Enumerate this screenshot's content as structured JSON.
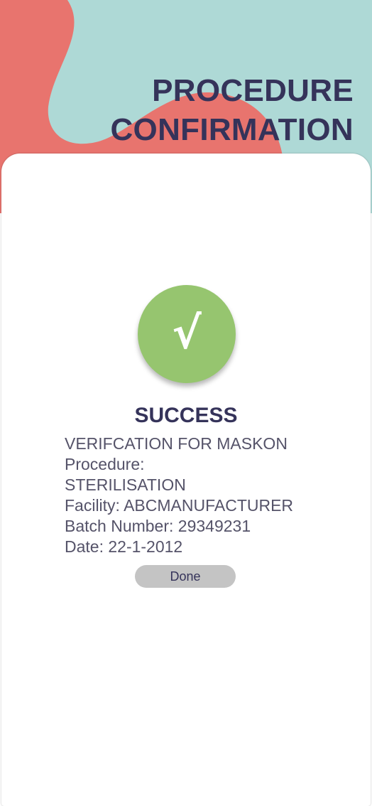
{
  "header": {
    "title_line1": "PROCEDURE",
    "title_line2": "CONFIRMATION"
  },
  "status": {
    "icon": "check-icon",
    "icon_glyph": "√",
    "heading": "SUCCESS"
  },
  "details": {
    "line1": "VERIFCATION FOR MASKON",
    "line2": "Procedure:",
    "line3": "STERILISATION",
    "line4": "Facility: ABCMANUFACTURER",
    "line5": "Batch Number: 29349231",
    "line6": "Date: 22-1-2012"
  },
  "actions": {
    "done_label": "Done"
  },
  "colors": {
    "header_teal": "#aed9d6",
    "header_coral": "#e8746e",
    "title_navy": "#35335a",
    "success_green": "#96c56f",
    "button_gray": "#c4c4c4",
    "body_text": "#555369"
  }
}
